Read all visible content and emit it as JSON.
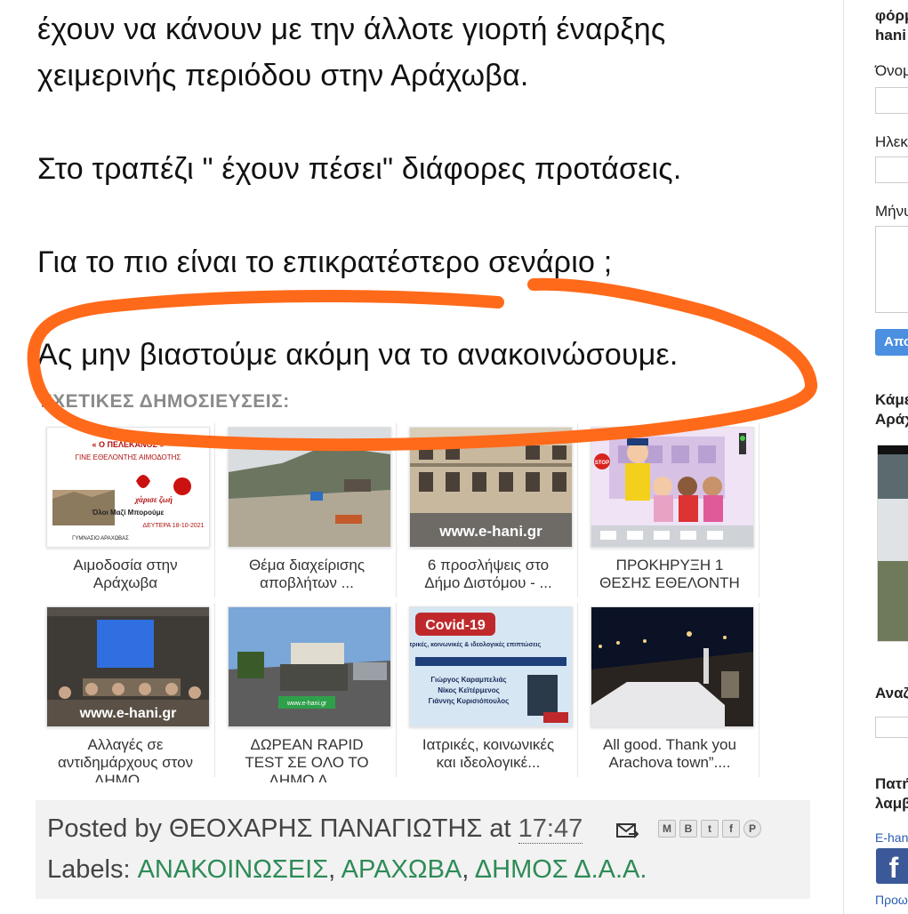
{
  "article": {
    "line1": "έχουν να κάνουν με την άλλοτε γιορτή έναρξης",
    "line2": "χειμερινής περιόδου στην Αράχωβα.",
    "line3": "Στο τραπέζι   \" έχουν πέσει\" διάφορες  προτάσεις.",
    "line4": "Για το πιο είναι το επικρατέστερο σενάριο ;",
    "line5": "Ας μην βιαστούμε ακόμη να το ανακοινώσουμε."
  },
  "related": {
    "title": "ΣΧΕΤΙΚΕΣ ΔΗΜΟΣΙΕΥΣΕΙΣ:",
    "items": [
      {
        "caption": "Αιμοδοσία στην Αράχωβα",
        "thumb_text_1": "« Ο ΠΕΛΕΚΑΝΟΣ »",
        "thumb_text_2": "ΓΙΝΕ ΕΘΕΛΟΝΤΗΣ ΑΙΜΟΔΟΤΗΣ",
        "thumb_text_3": "χάρισε ζωή",
        "thumb_text_4": "Όλοι Μαζί Μπορούμε",
        "thumb_text_5": "ΔΕΥΤΕΡΑ 18-10-2021",
        "thumb_text_6": "ΓΥΜΝΑΣΙΟ ΑΡΑΧΩΒΑΣ"
      },
      {
        "caption": "Θέμα διαχείρισης αποβλήτων ..."
      },
      {
        "caption": "6 προσλήψεις στο Δήμο Διστόμου - ...",
        "watermark": "www.e-hani.gr"
      },
      {
        "caption": "ΠΡΟΚΗΡΥΞΗ 1 ΘΕΣΗΣ ΕΘΕΛΟΝΤΗ ...",
        "sign": "STOP"
      },
      {
        "caption": "Αλλαγές σε αντιδημάρχους στον ΔΗΜΟ ...",
        "watermark": "www.e-hani.gr"
      },
      {
        "caption": "ΔΩΡΕΑΝ RAPID TEST ΣΕ ΟΛΟ ΤΟ ΔΗΜΟ Δ....",
        "watermark": "www.e-hani.gr"
      },
      {
        "caption": "Ιατρικές, κοινωνικές και ιδεολογικέ...",
        "poster_title": "Covid-19",
        "poster_sub": "Ιατρικές, κοινωνικές & ιδεολογικές επιπτώσεις",
        "name1": "Γιώργος Καραμπελιάς",
        "name2": "Νίκος Κεϊτέρμενος",
        "name3": "Γιάννης Κυρισιόπουλος"
      },
      {
        "caption": "All good. Thank you Arachova town”...."
      }
    ]
  },
  "footer": {
    "posted_by": "Posted by ",
    "author": "ΘΕΟΧΑΡΗΣ ΠΑΝΑΓΙΩΤΗΣ",
    "at": " at ",
    "time": "17:47",
    "labels_prefix": "Labels: ",
    "label1": "ΑΝΑΚΟΙΝΩΣΕΙΣ",
    "label2": "ΑΡΑΧΩΒΑ",
    "label3": "ΔΗΜΟΣ Δ.Α.Α.",
    "sep": ", "
  },
  "sidebar": {
    "form_title_1": "φόρμ",
    "form_title_2": "hani",
    "name_label": "Όνομ",
    "email_label": "Ηλεκ",
    "message_label": "Μήνυ",
    "send_button": "Απο",
    "widget1_line1": "Κάμε",
    "widget1_line2": "Αράχ",
    "search_title": "Αναζ",
    "widget3_line1": "Πατή",
    "widget3_line2": "λαμβ",
    "fb_link": "E-hani",
    "fb_icon": "f",
    "bottom_link": "Προω"
  },
  "colors": {
    "annotation_orange": "#ff6a1a",
    "label_green": "#2e8b57",
    "button_blue": "#4a8fe0"
  }
}
